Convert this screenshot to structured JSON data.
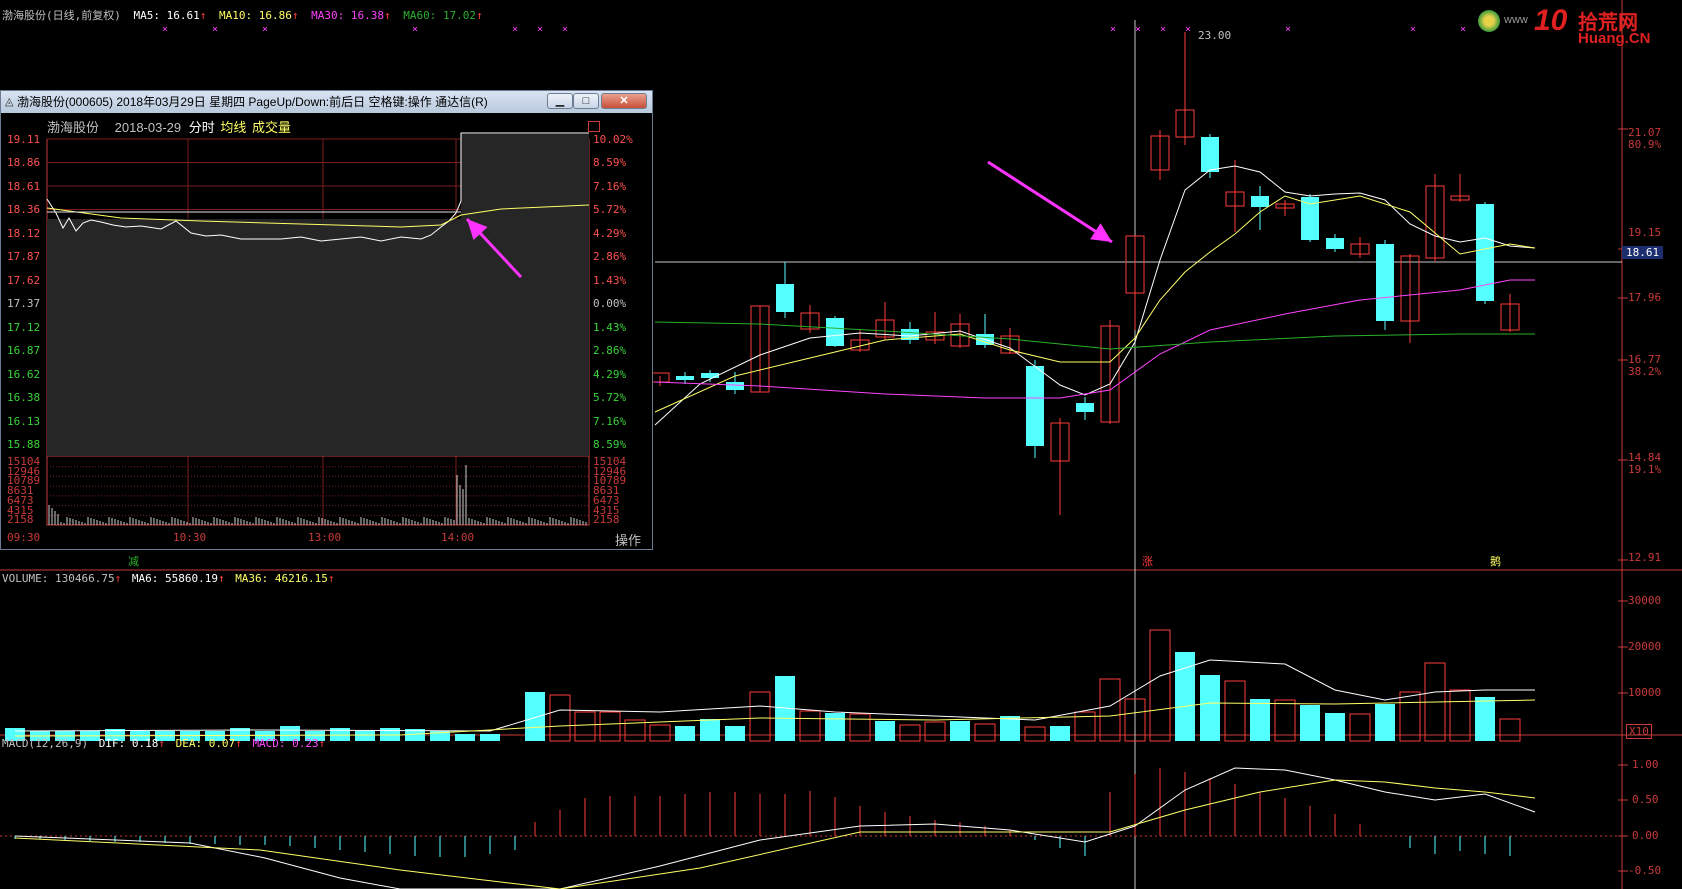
{
  "kline_header": {
    "title": "渤海股份(日线,前复权)",
    "ma5": "MA5: 16.61",
    "ma10": "MA10: 16.86",
    "ma30": "MA30: 16.38",
    "ma60": "MA60: 17.02",
    "arrow": "↑"
  },
  "logo": {
    "number": "10",
    "cn": "拾荒网",
    "url": "Huang.CN",
    "www": "www"
  },
  "price_axis": [
    "21.07",
    "80.9%",
    "19.15",
    "18.61",
    "17.96",
    "16.77",
    "38.2%",
    "14.84",
    "19.1%",
    "12.91"
  ],
  "kline_annotations": {
    "high_label": "23.00",
    "bottom_left_mark": "减",
    "bottom_mid_mark": "涨",
    "bottom_right_mark": "鹅"
  },
  "volume_header": {
    "text": "VOLUME: 130466.75",
    "ma6": "MA6: 55860.19",
    "ma36": "MA36: 46216.15",
    "arrow": "↑"
  },
  "volume_axis": [
    "30000",
    "20000",
    "10000",
    "X10"
  ],
  "macd_header": {
    "label": "MACD(12,26,9)",
    "dif": "DIF: 0.18",
    "dea": "DEA: 0.07",
    "macd": "MACD: 0.23",
    "arrow": "↑"
  },
  "macd_axis": [
    "1.00",
    "0.50",
    "0.00",
    "-0.50"
  ],
  "popup": {
    "title": "渤海股份(000605) 2018年03月29日 星期四 PageUp/Down:前后日 空格键:操作 通达信(R)",
    "toolbar_name": "渤海股份",
    "toolbar_date": "2018-03-29",
    "toolbar_tab1": "分时",
    "toolbar_tab2": "均线",
    "toolbar_tab3": "成交量",
    "left_prices": [
      "19.11",
      "18.86",
      "18.61",
      "18.36",
      "18.12",
      "17.87",
      "17.62",
      "17.37",
      "17.12",
      "16.87",
      "16.62",
      "16.38",
      "16.13",
      "15.88"
    ],
    "right_pcts": [
      "10.02%",
      "8.59%",
      "7.16%",
      "5.72%",
      "4.29%",
      "2.86%",
      "1.43%",
      "0.00%",
      "1.43%",
      "2.86%",
      "4.29%",
      "5.72%",
      "7.16%",
      "8.59%"
    ],
    "vol_labels": [
      "15104",
      "12946",
      "10789",
      "8631",
      "6473",
      "4315",
      "2158"
    ],
    "times": [
      "09:30",
      "10:30",
      "13:00",
      "14:00"
    ],
    "action_button": "操作",
    "btn_min": "▁",
    "btn_max": "□",
    "btn_close": "✕"
  },
  "colors": {
    "up": "#ff3c3c",
    "down": "#54ffff",
    "ma5": "#ffffff",
    "ma10": "#ffff66",
    "ma30": "#ff44ff",
    "ma60": "#2ab02a",
    "axis": "#c83a3a",
    "arrow": "#ff33ff"
  }
}
